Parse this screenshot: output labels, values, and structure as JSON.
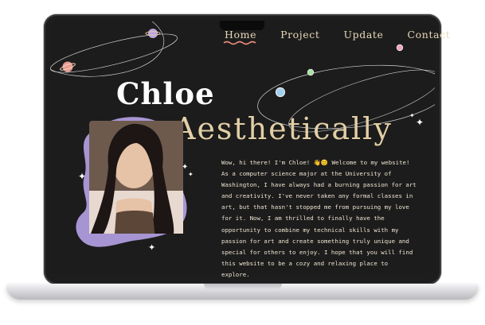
{
  "nav": {
    "items": [
      "Home",
      "Project",
      "Update",
      "Contact"
    ],
    "active": "Home"
  },
  "hero": {
    "name": "Chloe",
    "tagline": "Aesthetically"
  },
  "intro": {
    "text": "Wow, hi there! I'm Chloe! 👋😊 Welcome to my website! As a computer science major at the University of Washington, I have always had a burning passion for art and creativity. I've never taken any formal classes in art, but that hasn't stopped me from pursuing my love for it. Now, I am thrilled to finally have the opportunity to combine my technical skills with my passion for art and create something truly unique and special for others to enjoy. I hope that you will find this website to be a cozy and relaxing place to explore."
  },
  "icons": [
    "sparkle-icon",
    "planet-icon",
    "squiggle-underline-icon"
  ],
  "colors": {
    "background": "#1c1c1c",
    "accent": "#e3cfa6",
    "blob": "#a795d3",
    "nav": "#e7d8b8"
  }
}
